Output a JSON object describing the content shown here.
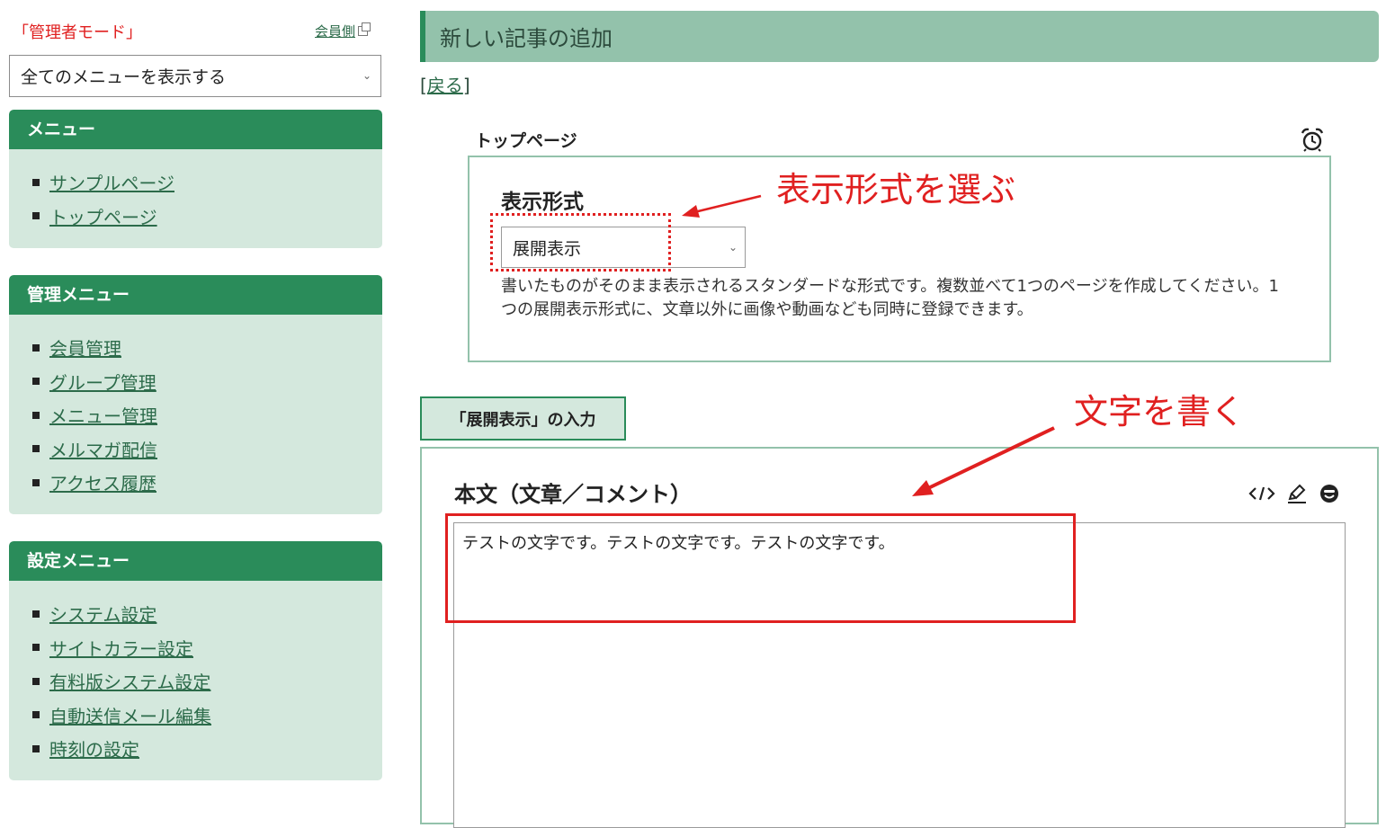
{
  "sidebar": {
    "admin_mode": "「管理者モード」",
    "member_link": "会員側",
    "menu_select": "全てのメニューを表示する",
    "panels": [
      {
        "title": "メニュー",
        "items": [
          "サンプルページ",
          "トップページ"
        ]
      },
      {
        "title": "管理メニュー",
        "items": [
          "会員管理",
          "グループ管理",
          "メニュー管理",
          "メルマガ配信",
          "アクセス履歴"
        ]
      },
      {
        "title": "設定メニュー",
        "items": [
          "システム設定",
          "サイトカラー設定",
          "有料版システム設定",
          "自動送信メール編集",
          "時刻の設定"
        ]
      }
    ]
  },
  "main": {
    "page_title": "新しい記事の追加",
    "back_label": "戻る",
    "section_label": "トップページ",
    "format": {
      "title": "表示形式",
      "selected": "展開表示",
      "description": "書いたものがそのまま表示されるスタンダードな形式です。複数並べて1つのページを作成してください。1つの展開表示形式に、文章以外に画像や動画なども同時に登録できます。"
    },
    "input_tab": "「展開表示」の入力",
    "body_title": "本文（文章／コメント）",
    "body_text": "テストの文字です。テストの文字です。テストの文字です。"
  },
  "annotations": {
    "choose_format": "表示形式を選ぶ",
    "write_text": "文字を書く",
    "color": "#e02020"
  },
  "icons": [
    "external-link-icon",
    "chevron-down-icon",
    "alarm-clock-icon",
    "code-icon",
    "highlighter-icon",
    "emoji-icon"
  ],
  "colors": {
    "brand_green": "#2a8c5a",
    "panel_bg": "#d4e8dd",
    "header_bg": "#93c2ab",
    "annotation_red": "#e02020"
  }
}
